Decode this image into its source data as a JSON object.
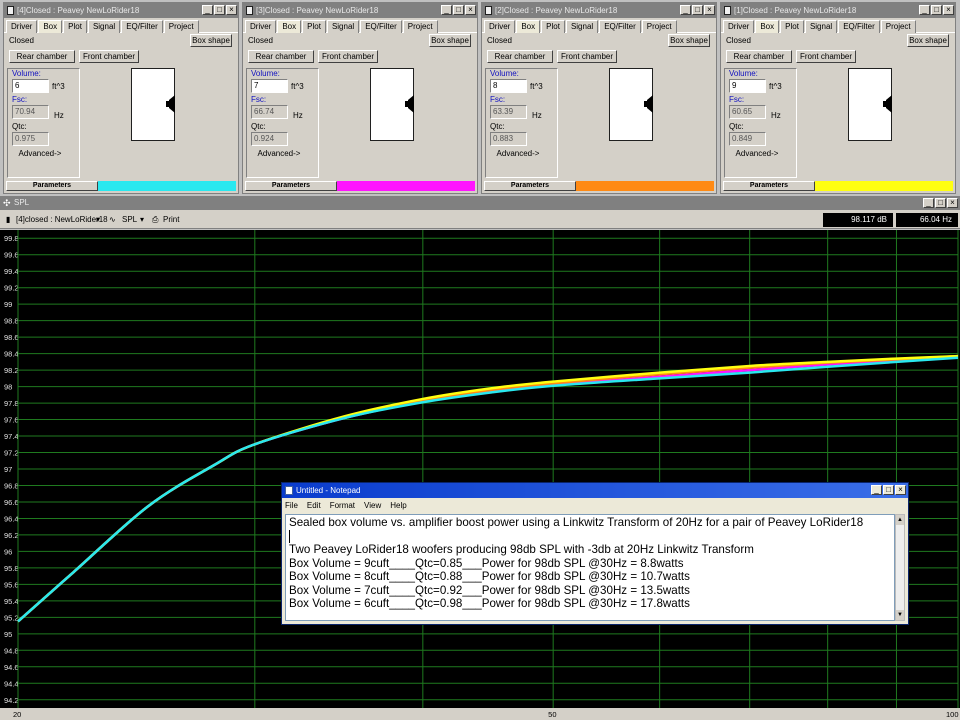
{
  "tabs": [
    "Driver",
    "Box",
    "Plot",
    "Signal",
    "EQ/Filter",
    "Project"
  ],
  "common": {
    "closed": "Closed",
    "box_shape": "Box shape",
    "rear": "Rear chamber",
    "front": "Front chamber",
    "volume_lbl": "Volume:",
    "fsc_lbl": "Fsc:",
    "qtc_lbl": "Qtc:",
    "unit_vol": "ft^3",
    "unit_hz": "Hz",
    "advanced": "Advanced->",
    "parameters": "Parameters"
  },
  "windows": [
    {
      "title": "[4]Closed : Peavey NewLoRider18",
      "volume": "6",
      "fsc": "70.94",
      "qtc": "0.975",
      "color": "#29e8ef"
    },
    {
      "title": "[3]Closed : Peavey NewLoRider18",
      "volume": "7",
      "fsc": "66.74",
      "qtc": "0.924",
      "color": "#ff14ff"
    },
    {
      "title": "[2]Closed : Peavey NewLoRider18",
      "volume": "8",
      "fsc": "63.39",
      "qtc": "0.883",
      "color": "#ff8a14"
    },
    {
      "title": "[1]Closed : Peavey NewLoRider18",
      "volume": "9",
      "fsc": "60.65",
      "qtc": "0.849",
      "color": "#ffff10"
    }
  ],
  "spl": {
    "title": "SPL",
    "selector": "[4]closed : NewLoRider18",
    "mode": "SPL",
    "print": "Print",
    "readout_db": "98.117 dB",
    "readout_hz": "66.04 Hz"
  },
  "notepad": {
    "title": "Untitled - Notepad",
    "menu": [
      "File",
      "Edit",
      "Format",
      "View",
      "Help"
    ],
    "lines": [
      "Sealed box volume vs. amplifier boost power using a Linkwitz Transform of 20Hz for a pair of Peavey LoRider18",
      "",
      "Two Peavey LoRider18 woofers producing 98db SPL with -3db at 20Hz Linkwitz Transform",
      "Box Volume = 9cuft____Qtc=0.85___Power for 98db SPL @30Hz = 8.8watts",
      "Box Volume = 8cuft____Qtc=0.88___Power for 98db SPL @30Hz = 10.7watts",
      "Box Volume = 7cuft____Qtc=0.92___Power for 98db SPL @30Hz = 13.5watts",
      "Box Volume = 6cuft____Qtc=0.98___Power for 98db SPL @30Hz = 17.8watts"
    ]
  },
  "chart_data": {
    "type": "line",
    "x_scale": "log",
    "xlim": [
      20,
      100
    ],
    "ylim": [
      94.1,
      99.9
    ],
    "x_ticks": [
      "20",
      "50",
      "100"
    ],
    "y_ticks": [
      "99.8",
      "99.6",
      "99.4",
      "99.2",
      "99",
      "98.8",
      "98.6",
      "98.4",
      "98.2",
      "98",
      "97.8",
      "97.6",
      "97.4",
      "97.2",
      "97",
      "96.8",
      "96.6",
      "96.4",
      "96.2",
      "96",
      "95.8",
      "95.6",
      "95.4",
      "95.2",
      "95",
      "94.8",
      "94.6",
      "94.4",
      "94.2"
    ],
    "grid": true,
    "x": [
      20,
      22,
      25,
      28,
      30,
      35,
      40,
      45,
      50,
      60,
      70,
      80,
      90,
      100
    ],
    "series": [
      {
        "color": "#ff14ff",
        "values": [
          95.15,
          95.75,
          96.55,
          97.05,
          97.3,
          97.62,
          97.82,
          97.95,
          98.02,
          98.12,
          98.2,
          98.27,
          98.32,
          98.37
        ]
      },
      {
        "color": "#ff8a14",
        "values": [
          95.15,
          95.75,
          96.55,
          97.05,
          97.3,
          97.63,
          97.83,
          97.96,
          98.04,
          98.15,
          98.23,
          98.29,
          98.33,
          98.37
        ]
      },
      {
        "color": "#ffff10",
        "values": [
          95.15,
          95.75,
          96.55,
          97.05,
          97.3,
          97.64,
          97.85,
          97.98,
          98.06,
          98.17,
          98.25,
          98.3,
          98.34,
          98.37
        ]
      },
      {
        "color": "#29e8ef",
        "values": [
          95.15,
          95.75,
          96.55,
          97.05,
          97.3,
          97.62,
          97.81,
          97.93,
          98.01,
          98.1,
          98.17,
          98.24,
          98.3,
          98.35
        ]
      }
    ]
  }
}
